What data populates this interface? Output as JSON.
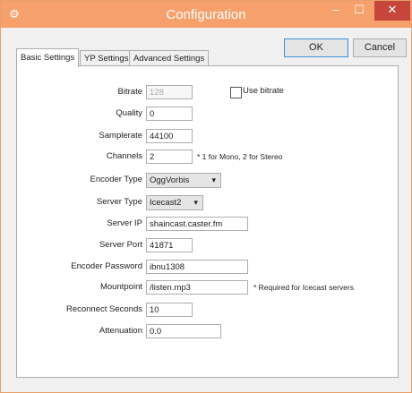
{
  "window": {
    "title": "Configuration"
  },
  "buttons": {
    "ok": "OK",
    "cancel": "Cancel"
  },
  "tabs": [
    {
      "label": "Basic Settings",
      "active": true
    },
    {
      "label": "YP Settings",
      "active": false
    },
    {
      "label": "Advanced Settings",
      "active": false
    }
  ],
  "form": {
    "bitrate": {
      "label": "Bitrate",
      "value": "128"
    },
    "use_bitrate": {
      "label": "Use bitrate",
      "checked": false
    },
    "quality": {
      "label": "Quality",
      "value": "0"
    },
    "samplerate": {
      "label": "Samplerate",
      "value": "44100"
    },
    "channels": {
      "label": "Channels",
      "value": "2",
      "note": "* 1 for Mono, 2 for Stereo"
    },
    "encoder_type": {
      "label": "Encoder Type",
      "value": "OggVorbis"
    },
    "server_type": {
      "label": "Server Type",
      "value": "Icecast2"
    },
    "server_ip": {
      "label": "Server IP",
      "value": "shaincast.caster.fm"
    },
    "server_port": {
      "label": "Server Port",
      "value": "41871"
    },
    "encoder_password": {
      "label": "Encoder Password",
      "value": "ibnu1308"
    },
    "mountpoint": {
      "label": "Mountpoint",
      "value": "/listen.mp3",
      "note": "* Required for Icecast servers"
    },
    "reconnect_seconds": {
      "label": "Reconnect Seconds",
      "value": "10"
    },
    "attenuation": {
      "label": "Attenuation",
      "value": "0.0"
    }
  },
  "colors": {
    "titlebar": "#f6a06c",
    "close_button": "#c7463b",
    "ok_border": "#3d8fd6"
  }
}
